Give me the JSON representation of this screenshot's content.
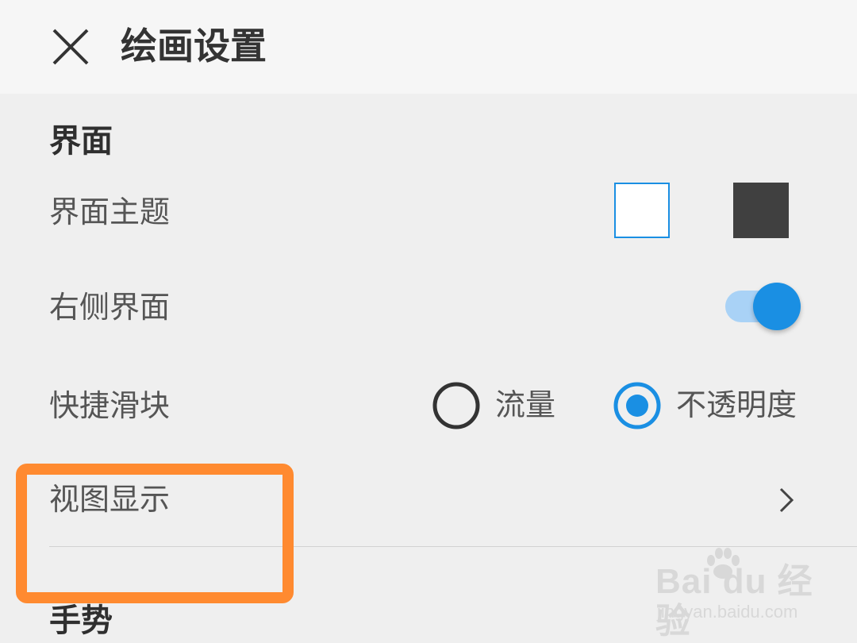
{
  "header": {
    "title": "绘画设置",
    "close_icon": "close-icon"
  },
  "sections": [
    {
      "title": "界面",
      "rows": [
        {
          "label": "界面主题",
          "theme_options": [
            "light",
            "dark"
          ],
          "selected": "light"
        },
        {
          "label": "右侧界面",
          "toggle_on": true
        },
        {
          "label": "快捷滑块",
          "radio_options": [
            "流量",
            "不透明度"
          ],
          "selected": "不透明度"
        },
        {
          "label": "视图显示",
          "icon": "chevron-right-icon"
        }
      ]
    },
    {
      "title": "手势"
    }
  ],
  "colors": {
    "accent": "#1a8fe3",
    "toggle_track": "#a9d2f6",
    "dark_theme": "#404040",
    "highlight": "#ff8a30",
    "background": "#efefef"
  },
  "watermark": {
    "brand": "Bai du 经验",
    "url": "jingyan.baidu.com"
  }
}
